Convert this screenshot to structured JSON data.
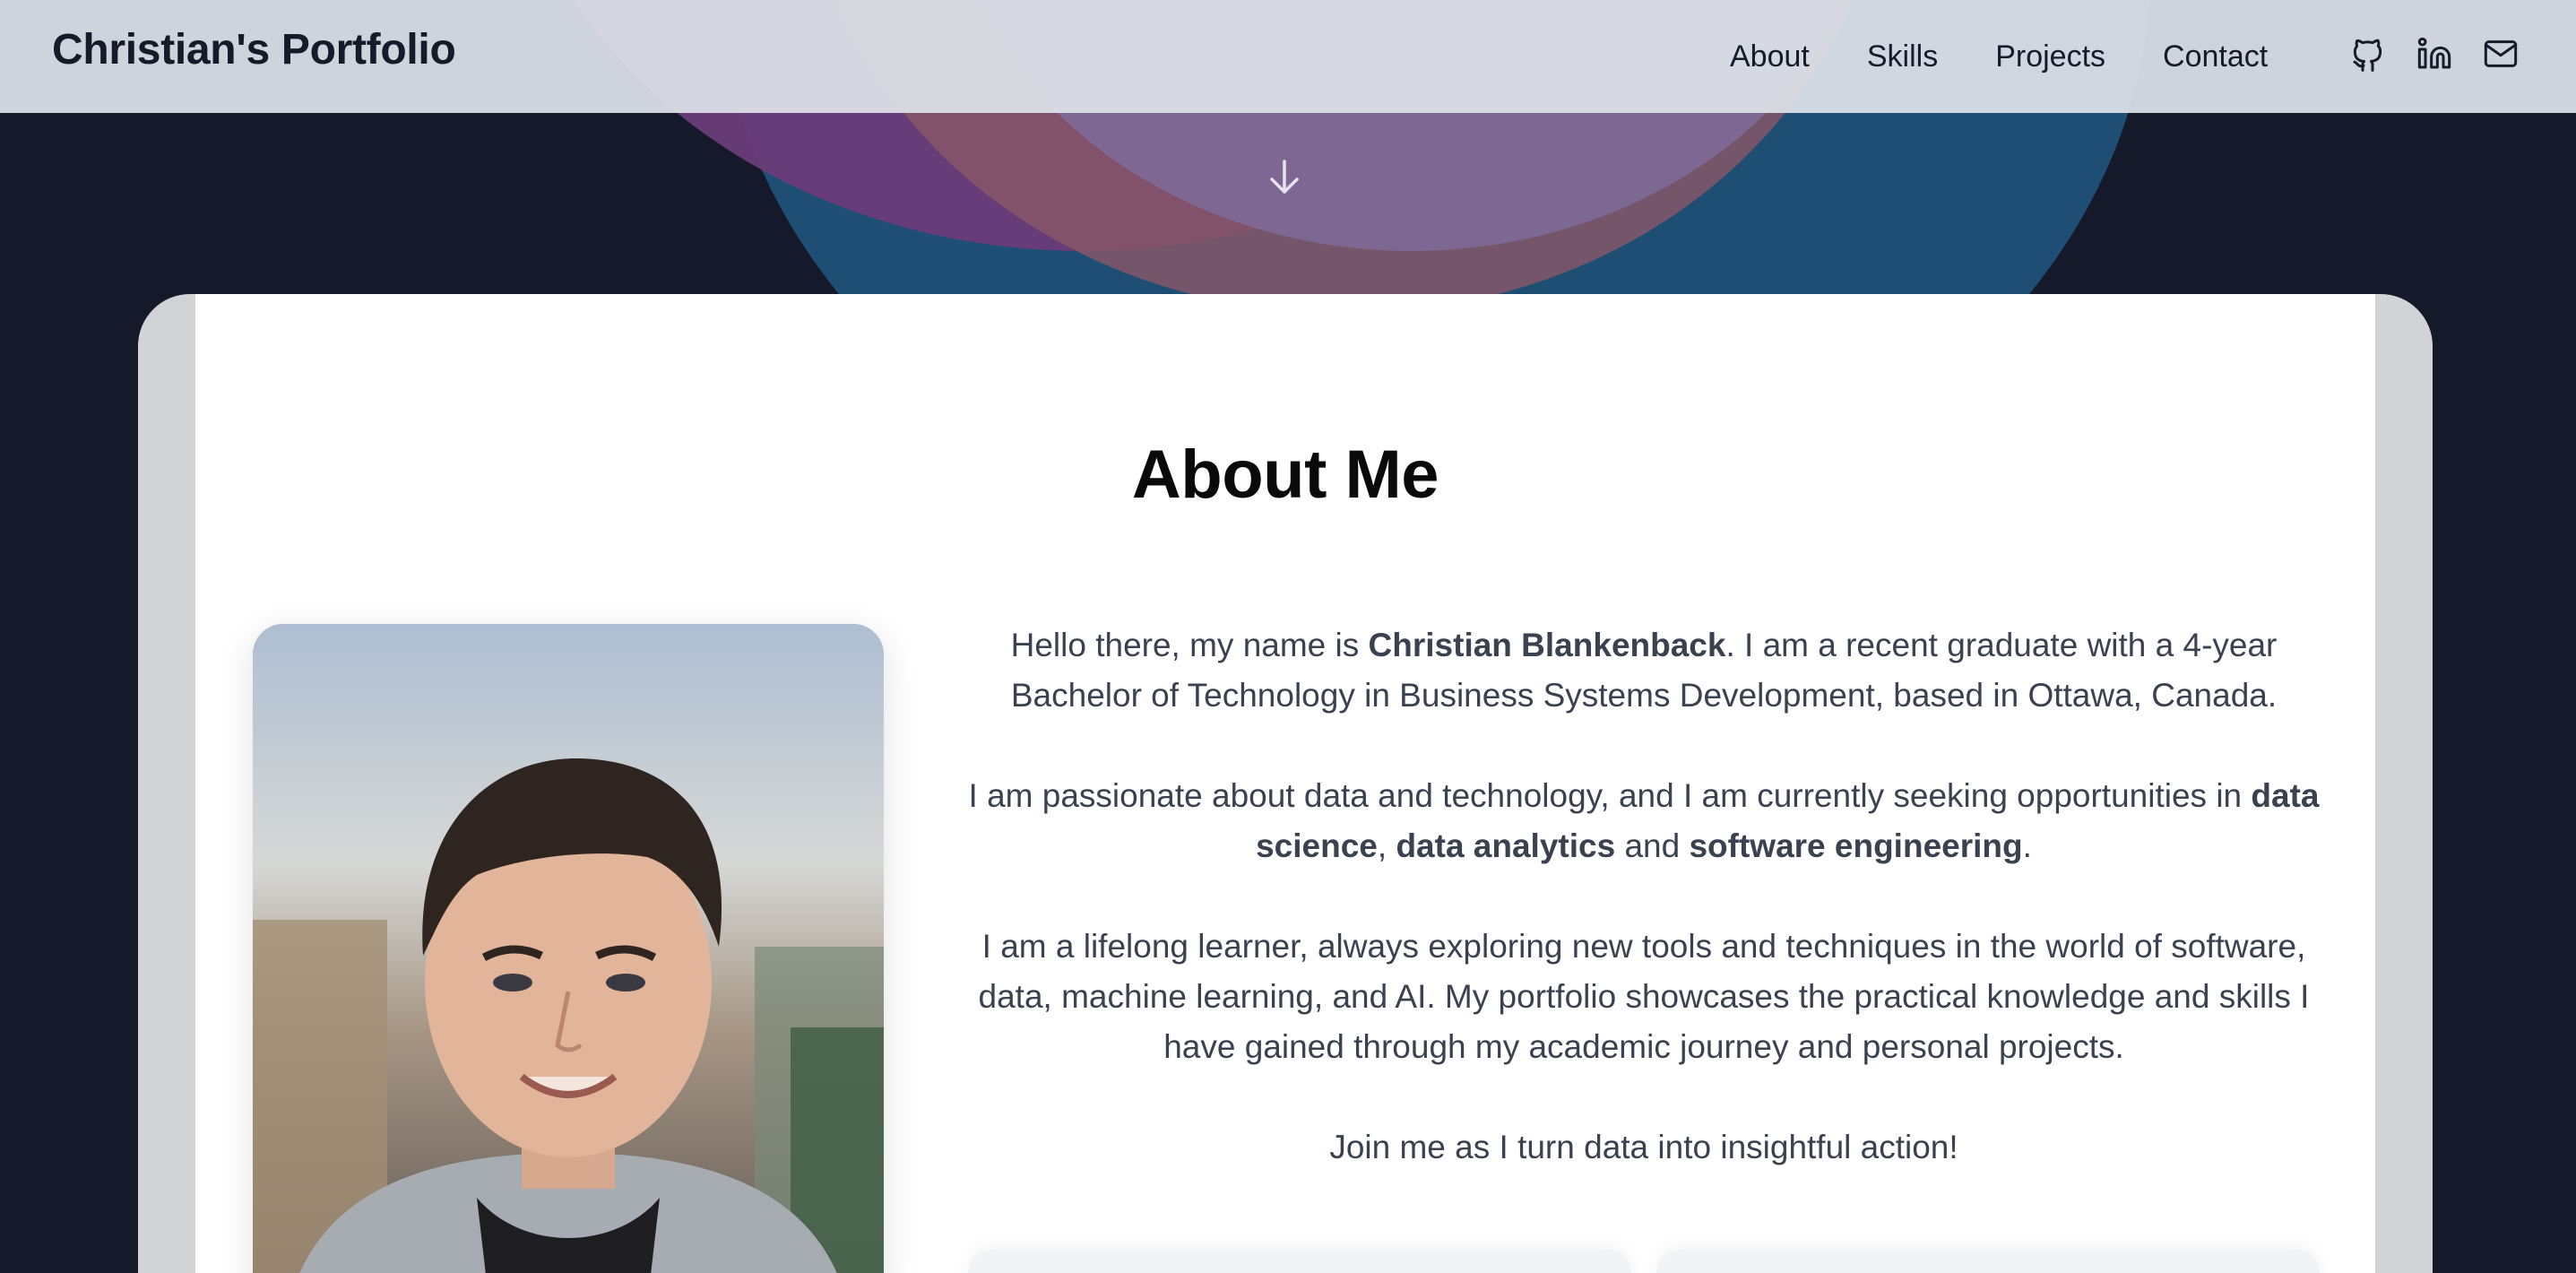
{
  "header": {
    "brand": "Christian's Portfolio",
    "nav": [
      "About",
      "Skills",
      "Projects",
      "Contact"
    ],
    "social_icons": [
      "github-icon",
      "linkedin-icon",
      "mail-icon"
    ]
  },
  "hero": {
    "scroll_icon": "arrow-down-icon",
    "colors": {
      "teal": "#1e4e74",
      "purple": "#6a3c78",
      "rose": "#8a5866",
      "lavender": "#7e6c9a",
      "background": "#141a29"
    }
  },
  "about": {
    "title": "About Me",
    "photo_icon": "profile-photo",
    "p1": {
      "before": "Hello there, my name is ",
      "name": "Christian Blankenback",
      "after": ". I am a recent graduate with a 4-year Bachelor of Technology in Business Systems Development, based in Ottawa, Canada."
    },
    "p2": {
      "before": "I am passionate about data and technology, and I am currently seeking opportunities in ",
      "k1": "data science",
      "sep1": ", ",
      "k2": "data analytics",
      "sep2": " and ",
      "k3": "software engineering",
      "end": "."
    },
    "p3": "I am a lifelong learner, always exploring new tools and techniques in the world of software, data, machine learning, and AI. My portfolio showcases the practical knowledge and skills I have gained through my academic journey and personal projects.",
    "p4": "Join me as I turn data into insightful action!"
  }
}
